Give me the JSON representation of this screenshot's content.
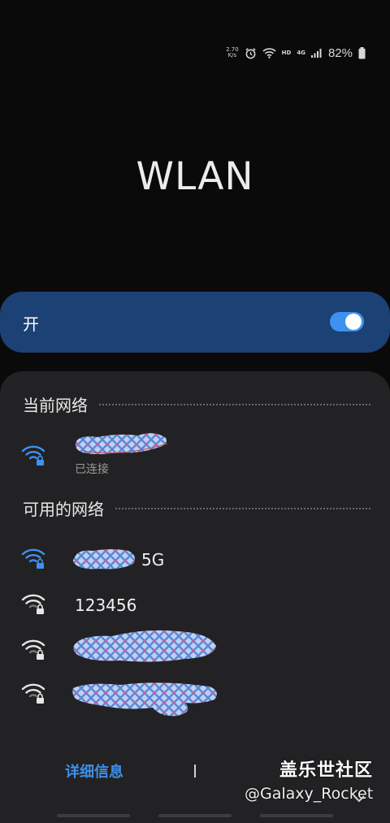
{
  "status_bar": {
    "net_speed_value": "2.70",
    "net_speed_unit": "K/s",
    "hd_label": "HD",
    "network_type": "4G",
    "battery_percent": "82%"
  },
  "title": "WLAN",
  "wifi_toggle": {
    "label": "开",
    "state": "on"
  },
  "current_section": {
    "title": "当前网络",
    "network": {
      "name": "",
      "status": "已连接",
      "name_redacted": true,
      "icon": "wifi-locked-icon",
      "icon_color": "#3e91f0"
    }
  },
  "available_section": {
    "title": "可用的网络",
    "networks": [
      {
        "name_suffix": "5G",
        "name_redacted": true,
        "icon": "wifi-locked-icon",
        "icon_color": "#3e91f0"
      },
      {
        "name": "123456",
        "name_redacted": false,
        "icon": "wifi-locked-icon",
        "icon_color": "#e6e6e6"
      },
      {
        "name": "",
        "name_redacted": true,
        "icon": "wifi-locked-icon",
        "icon_color": "#e6e6e6"
      },
      {
        "name": "",
        "name_redacted": true,
        "icon": "wifi-locked-icon",
        "icon_color": "#e6e6e6"
      }
    ]
  },
  "footer": {
    "details_label": "详细信息"
  },
  "watermark": {
    "line1": "盖乐世社区",
    "line2": "@Galaxy_Rocket"
  },
  "colors": {
    "background": "#0a0a0b",
    "toggle_bar": "#1c4174",
    "switch_on": "#3e91f0",
    "panel": "#222224",
    "accent": "#3f90e8"
  }
}
